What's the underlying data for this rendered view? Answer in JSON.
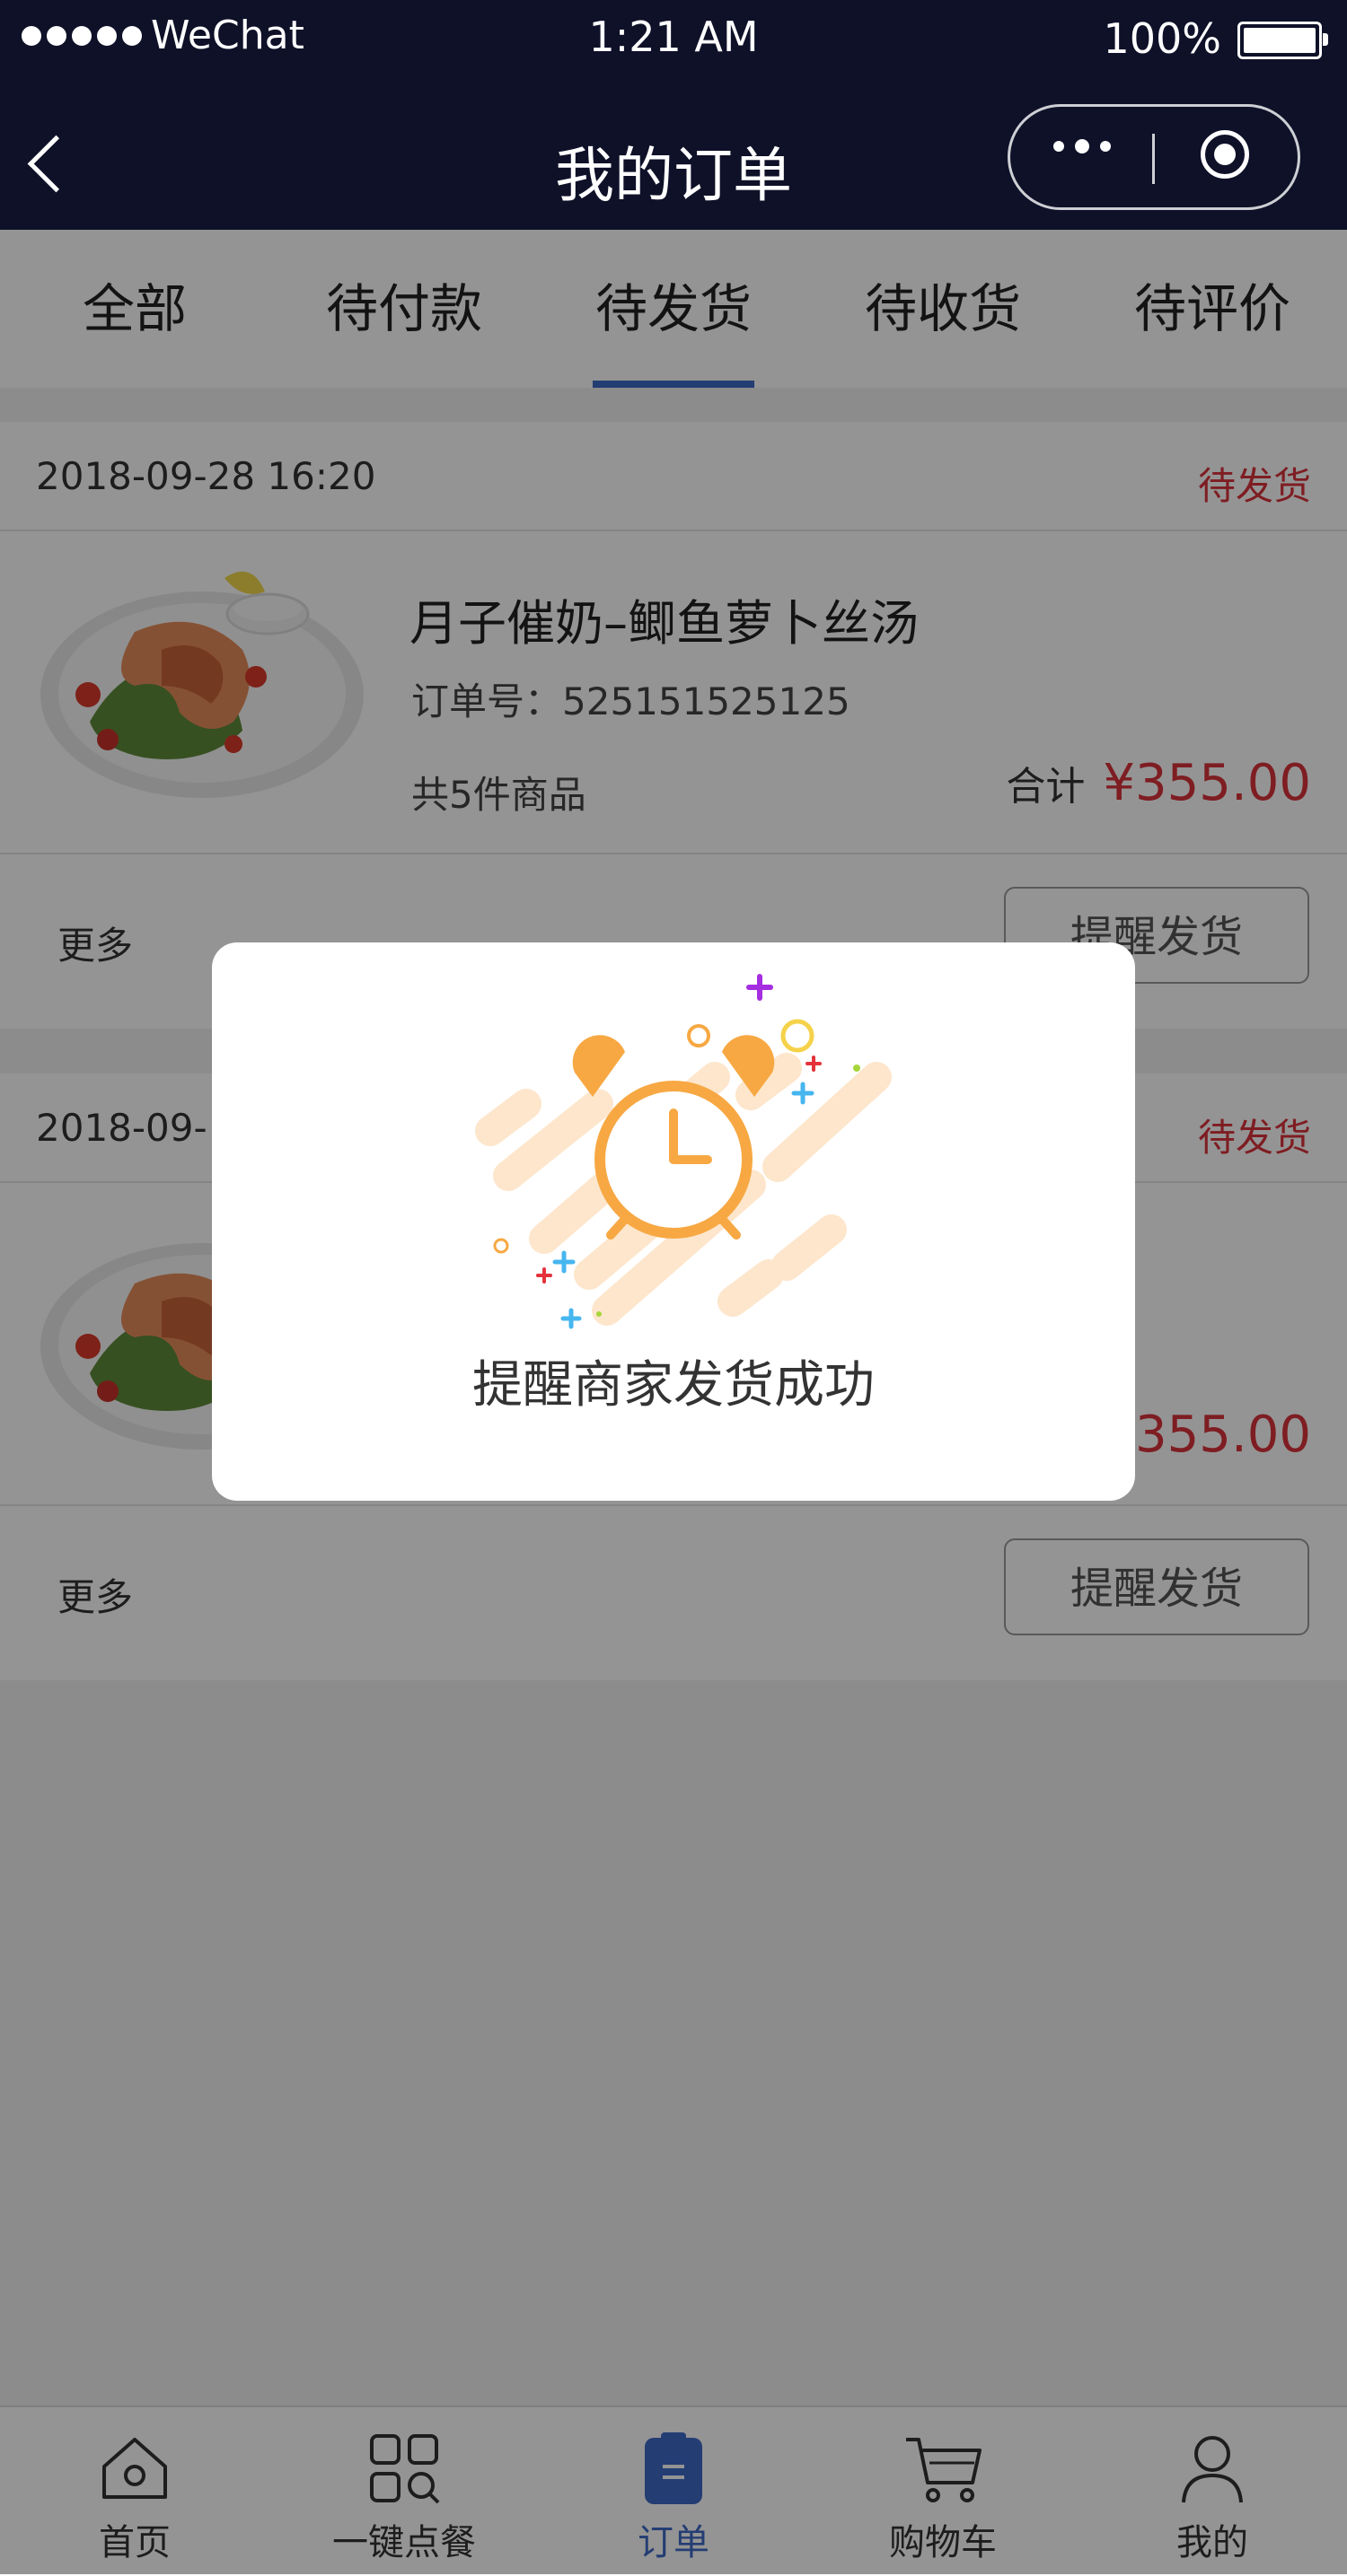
{
  "status_bar": {
    "carrier": "WeChat",
    "time": "1:21 AM",
    "battery": "100%"
  },
  "nav": {
    "title": "我的订单"
  },
  "tabs": [
    {
      "label": "全部"
    },
    {
      "label": "待付款"
    },
    {
      "label": "待发货",
      "active": true
    },
    {
      "label": "待收货"
    },
    {
      "label": "待评价"
    }
  ],
  "orders": [
    {
      "datetime": "2018-09-28   16:20",
      "status": "待发货",
      "product_name": "月子催奶–鲫鱼萝卜丝汤",
      "order_no": "订单号：525151525125",
      "item_count": "共5件商品",
      "total_label": "合计",
      "total": "¥355.00",
      "more": "更多",
      "action": "提醒发货"
    },
    {
      "datetime": "2018-09-",
      "status": "待发货",
      "product_name": "",
      "order_no": "",
      "item_count": "",
      "total_label": "",
      "total": "¥355.00",
      "more": "更多",
      "action": "提醒发货"
    }
  ],
  "modal": {
    "message": "提醒商家发货成功"
  },
  "tabbar": [
    {
      "label": "首页",
      "icon": "home-icon"
    },
    {
      "label": "一键点餐",
      "icon": "grid-search-icon"
    },
    {
      "label": "订单",
      "icon": "order-clipboard-icon",
      "active": true
    },
    {
      "label": "购物车",
      "icon": "cart-icon"
    },
    {
      "label": "我的",
      "icon": "user-icon"
    }
  ],
  "colors": {
    "nav_bg": "#0e1128",
    "accent": "#3f69c6",
    "price_red": "#d9323b",
    "clock_orange": "#f7a843"
  }
}
